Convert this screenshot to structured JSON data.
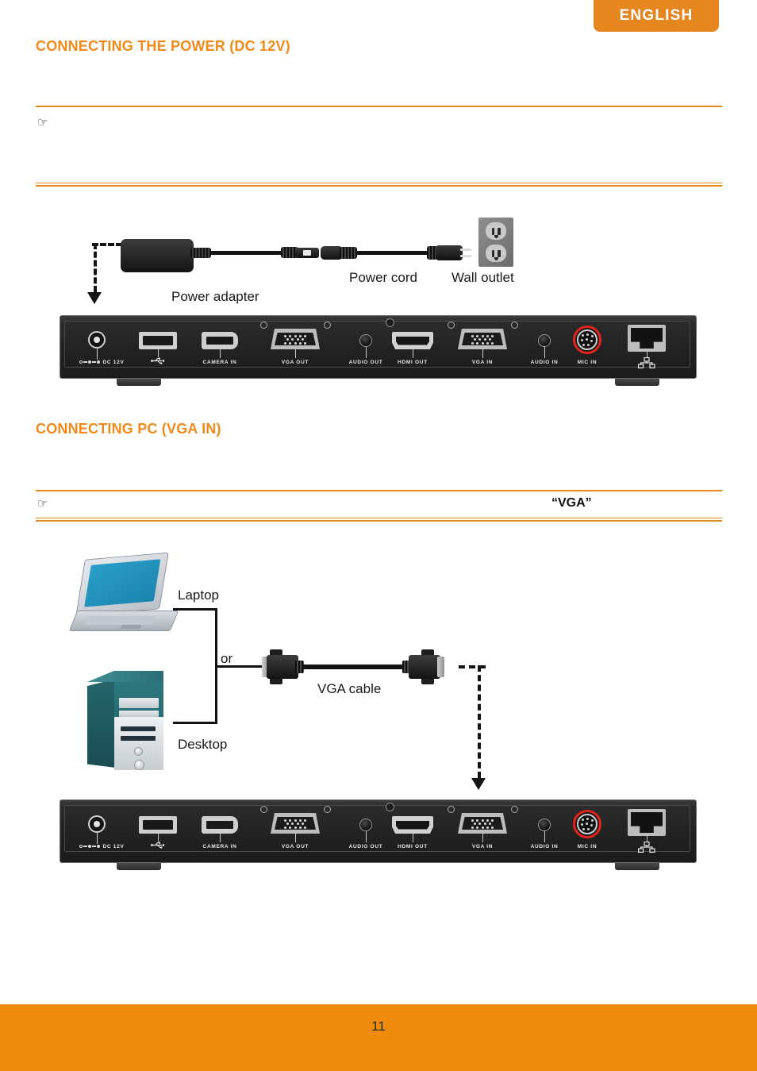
{
  "header": {
    "language_tab": "ENGLISH"
  },
  "sections": [
    {
      "id": "power",
      "heading": "CONNECTING THE POWER (DC 12V)",
      "note": {
        "icon": "pointing-hand-icon",
        "text": ""
      },
      "diagram": {
        "labels": {
          "power_adapter": "Power adapter",
          "power_cord": "Power cord",
          "wall_outlet": "Wall outlet"
        }
      }
    },
    {
      "id": "vga",
      "heading": "CONNECTING PC (VGA IN)",
      "note": {
        "icon": "pointing-hand-icon",
        "text": "“VGA”"
      },
      "diagram": {
        "labels": {
          "laptop": "Laptop",
          "desktop": "Desktop",
          "or": "or",
          "vga_cable": "VGA cable"
        }
      }
    }
  ],
  "device_panel": {
    "ports": [
      {
        "label": "DC 12V",
        "type": "dc-jack"
      },
      {
        "label": "",
        "type": "usb-port"
      },
      {
        "label": "CAMERA IN",
        "type": "camera-in-port"
      },
      {
        "label": "VGA OUT",
        "type": "vga-port"
      },
      {
        "label": "AUDIO OUT",
        "type": "audio-jack"
      },
      {
        "label": "HDMI OUT",
        "type": "hdmi-port"
      },
      {
        "label": "VGA IN",
        "type": "vga-port"
      },
      {
        "label": "AUDIO IN",
        "type": "audio-jack"
      },
      {
        "label": "MIC IN",
        "type": "mic-in-port"
      },
      {
        "label": "",
        "type": "rj45-lan-port"
      }
    ]
  },
  "footer": {
    "page_number": "11"
  },
  "colors": {
    "accent_orange": "#F18A1A",
    "tab_orange": "#E5861F",
    "footer_orange": "#EF8B0D",
    "rule_orange": "#E08A1E",
    "mic_red": "#E0231B"
  }
}
